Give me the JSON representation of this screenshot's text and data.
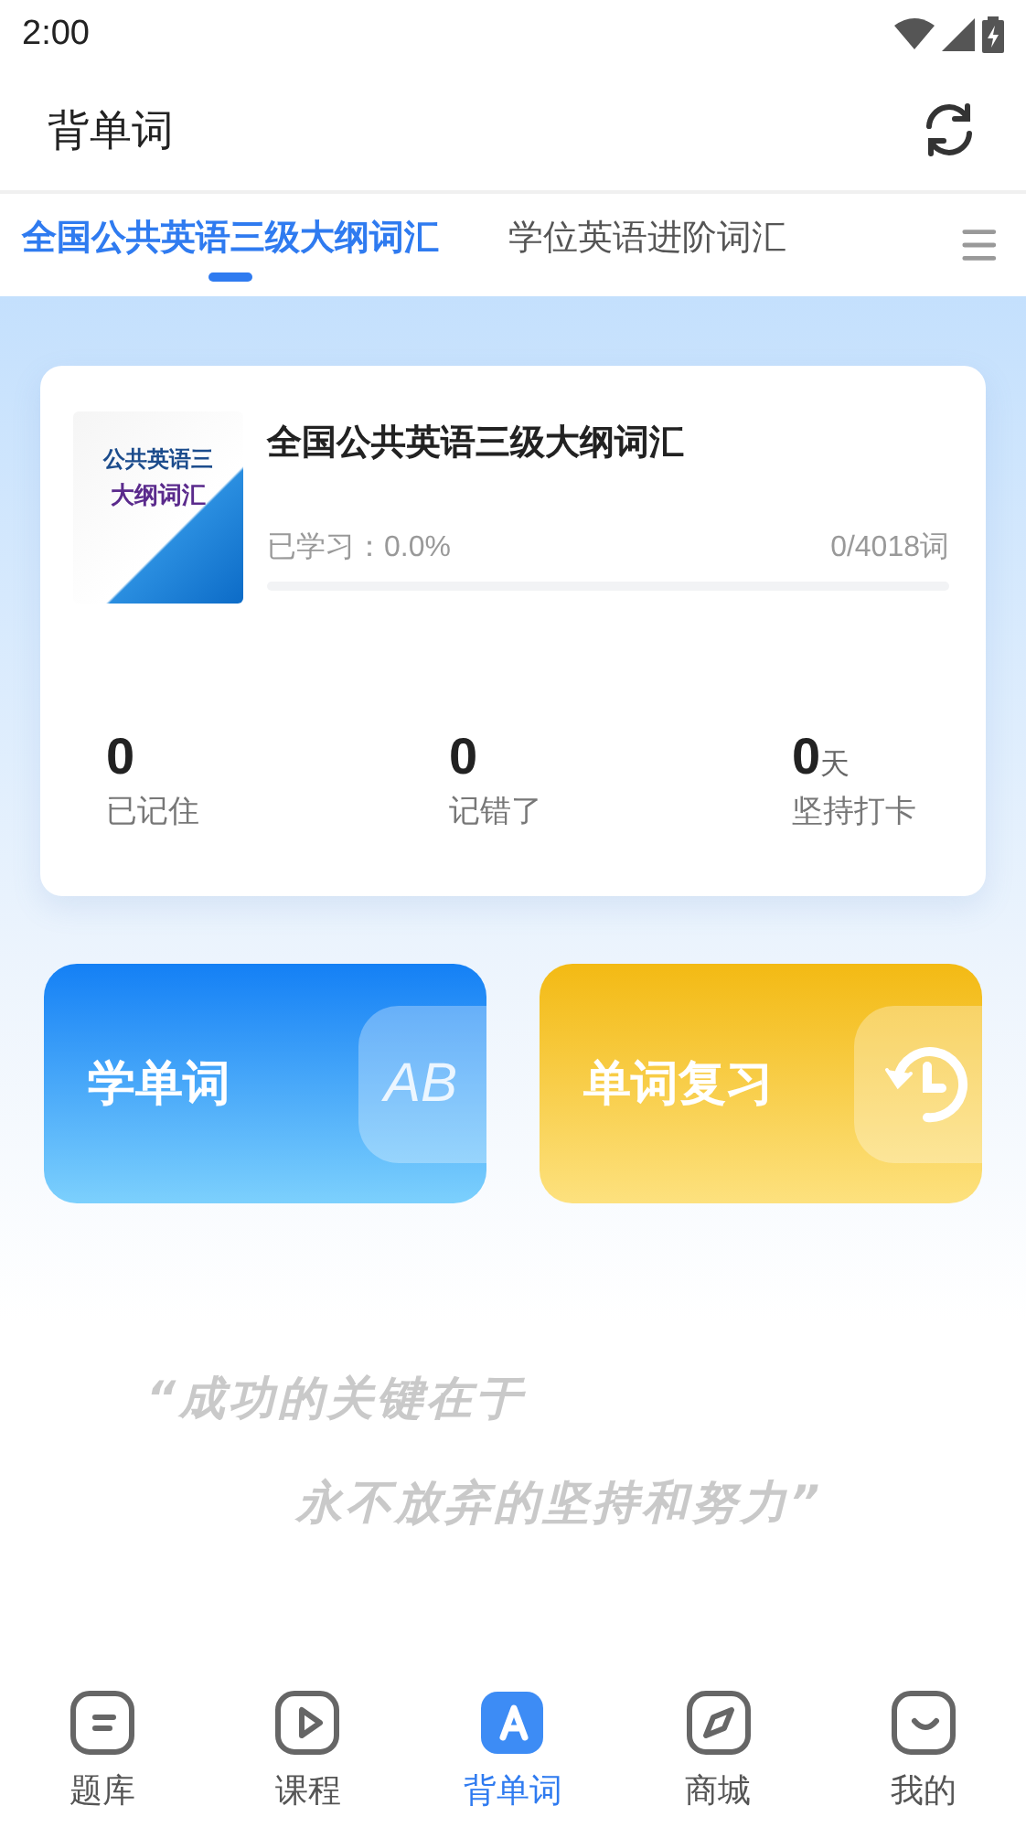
{
  "status_bar": {
    "time": "2:00"
  },
  "header": {
    "title": "背单词"
  },
  "tabs": [
    {
      "label": "全国公共英语三级大纲词汇",
      "selected": true
    },
    {
      "label": "学位英语进阶词汇",
      "selected": false
    }
  ],
  "book": {
    "cover_lines": [
      "公共英语三",
      "大纲词汇"
    ],
    "title": "全国公共英语三级大纲词汇",
    "progress_label": "已学习：0.0%",
    "count": "0/4018词",
    "level": 0
  },
  "stats": [
    {
      "value": "0",
      "label": "已记住"
    },
    {
      "value": "0",
      "label": "记错了"
    },
    {
      "value": "0",
      "unit": "天",
      "label": "坚持打卡"
    }
  ],
  "actions": [
    {
      "kind": "learn",
      "label": "学单词",
      "badge": "AB"
    },
    {
      "kind": "review",
      "label": "单词复习"
    }
  ],
  "quote": [
    "“成功的关键在于",
    "永不放弃的坚持和努力”"
  ],
  "nav": [
    {
      "label": "题库",
      "selected": false
    },
    {
      "label": "课程",
      "selected": false
    },
    {
      "label": "背单词",
      "selected": true
    },
    {
      "label": "商城",
      "selected": false
    },
    {
      "label": "我的",
      "selected": false
    }
  ]
}
